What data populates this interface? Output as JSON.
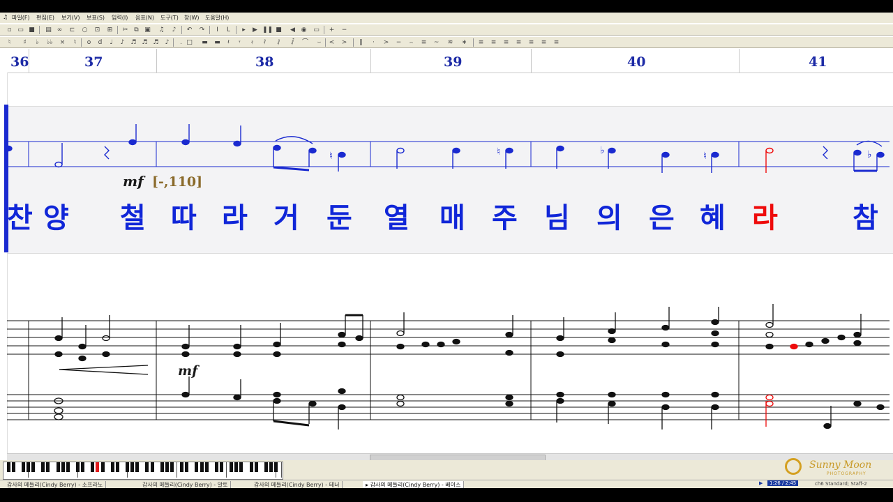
{
  "menu": [
    "파일(F)",
    "편집(E)",
    "보기(V)",
    "보표(S)",
    "입력(I)",
    "음표(N)",
    "도구(T)",
    "창(W)",
    "도움말(H)"
  ],
  "measures": [
    "36",
    "37",
    "38",
    "39",
    "40",
    "41"
  ],
  "lyrics": [
    "찬",
    "양",
    "철",
    "따",
    "라",
    "거",
    "둔",
    "열",
    "매",
    "주",
    "님",
    "의",
    "은",
    "혜",
    "라",
    "참"
  ],
  "active_lyric_index": 14,
  "dynamics": {
    "mark": "mf",
    "tempo": "[-,110]",
    "mark2": "mf"
  },
  "tabs": [
    "감사의 메들리(Cindy Berry) - 소프라노",
    "감사의 메들리(Cindy Berry) - 알토",
    "감사의 메들리(Cindy Berry) - 테너",
    "감사의 메들리(Cindy Berry) - 베이스"
  ],
  "active_tab": 3,
  "status": {
    "time": "1:26 / 2:45",
    "staff": "ch6 Standard; Staff-2"
  },
  "logo": {
    "name": "Sunny Moon",
    "sub": "PHOTOGRAPHY"
  },
  "colors": {
    "note_blue": "#1a2ad0",
    "lyric_blue": "#1026d8",
    "active_red": "#ee0b0b",
    "measure_blue": "#1c2aa6"
  }
}
